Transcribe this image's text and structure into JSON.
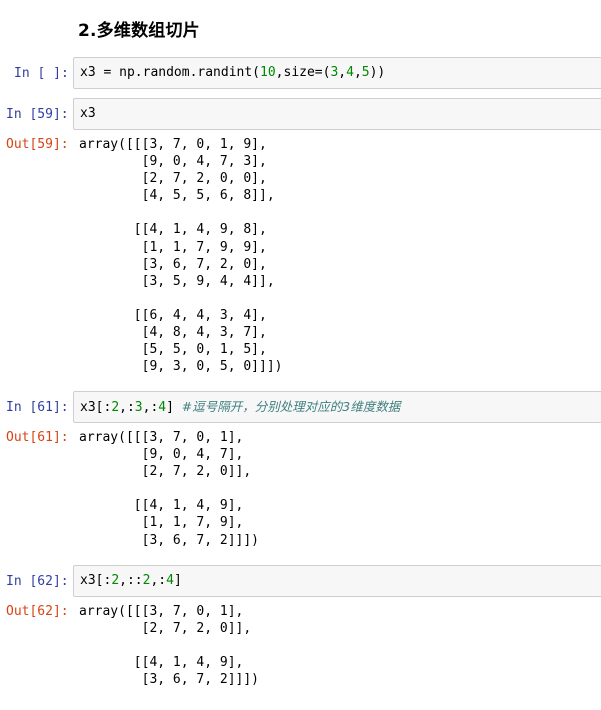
{
  "heading": "2.多维数组切片",
  "cells": [
    {
      "in_prompt": "In [ ]:",
      "code": [
        {
          "t": "txt",
          "v": "x3 = np.random.randint("
        },
        {
          "t": "num",
          "v": "10"
        },
        {
          "t": "txt",
          "v": ",size=("
        },
        {
          "t": "num",
          "v": "3"
        },
        {
          "t": "txt",
          "v": ","
        },
        {
          "t": "num",
          "v": "4"
        },
        {
          "t": "txt",
          "v": ","
        },
        {
          "t": "num",
          "v": "5"
        },
        {
          "t": "txt",
          "v": "))"
        }
      ]
    },
    {
      "in_prompt": "In [59]:",
      "code": [
        {
          "t": "txt",
          "v": "x3"
        }
      ],
      "out_prompt": "Out[59]:",
      "output": "array([[[3, 7, 0, 1, 9],\n        [9, 0, 4, 7, 3],\n        [2, 7, 2, 0, 0],\n        [4, 5, 5, 6, 8]],\n\n       [[4, 1, 4, 9, 8],\n        [1, 1, 7, 9, 9],\n        [3, 6, 7, 2, 0],\n        [3, 5, 9, 4, 4]],\n\n       [[6, 4, 4, 3, 4],\n        [4, 8, 4, 3, 7],\n        [5, 5, 0, 1, 5],\n        [9, 3, 0, 5, 0]]])"
    },
    {
      "in_prompt": "In [61]:",
      "code": [
        {
          "t": "txt",
          "v": "x3[:"
        },
        {
          "t": "num",
          "v": "2"
        },
        {
          "t": "txt",
          "v": ",:"
        },
        {
          "t": "num",
          "v": "3"
        },
        {
          "t": "txt",
          "v": ",:"
        },
        {
          "t": "num",
          "v": "4"
        },
        {
          "t": "txt",
          "v": "] "
        },
        {
          "t": "com",
          "v": "#逗号隔开，分别处理对应的3维度数据"
        }
      ],
      "out_prompt": "Out[61]:",
      "output": "array([[[3, 7, 0, 1],\n        [9, 0, 4, 7],\n        [2, 7, 2, 0]],\n\n       [[4, 1, 4, 9],\n        [1, 1, 7, 9],\n        [3, 6, 7, 2]]])"
    },
    {
      "in_prompt": "In [62]:",
      "code": [
        {
          "t": "txt",
          "v": "x3[:"
        },
        {
          "t": "num",
          "v": "2"
        },
        {
          "t": "txt",
          "v": ",::"
        },
        {
          "t": "num",
          "v": "2"
        },
        {
          "t": "txt",
          "v": ",:"
        },
        {
          "t": "num",
          "v": "4"
        },
        {
          "t": "txt",
          "v": "]"
        }
      ],
      "out_prompt": "Out[62]:",
      "output": "array([[[3, 7, 0, 1],\n        [2, 7, 2, 0]],\n\n       [[4, 1, 4, 9],\n        [3, 6, 7, 2]]])"
    }
  ],
  "colors": {
    "in_prompt": "#303f9f",
    "out_prompt": "#d84315",
    "number": "#008800",
    "comment": "#408080",
    "input_bg": "#f7f7f7",
    "input_border": "#cfcfcf"
  }
}
